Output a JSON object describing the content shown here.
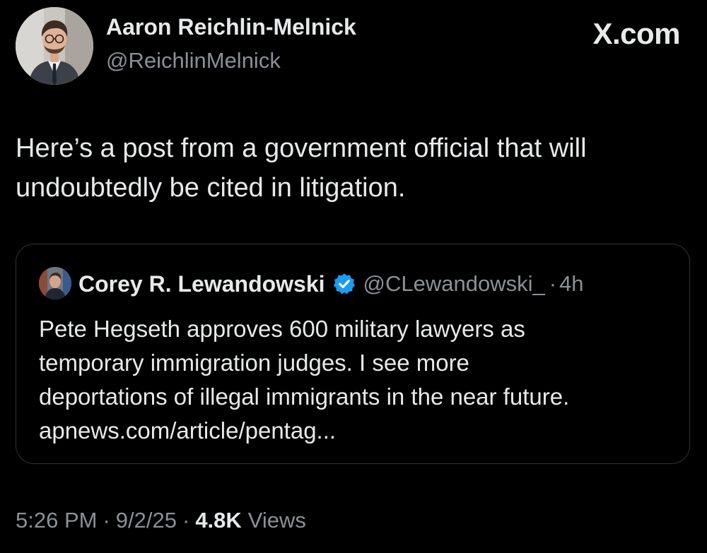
{
  "author": {
    "name": "Aaron Reichlin-Melnick",
    "handle": "@ReichlinMelnick"
  },
  "brand": "X.com",
  "post": {
    "text": "Here’s a post from a government official that will\nundoubtedly be cited in litigation."
  },
  "quoted": {
    "name": "Corey R. Lewandowski",
    "handle": "@CLewandowski_",
    "separator": "·",
    "time": "4h",
    "text": "Pete Hegseth approves 600 military lawyers as\ntemporary immigration judges.  I see more\ndeportations of illegal immigrants in the near future.\napnews.com/article/pentag..."
  },
  "footer": {
    "time": "5:26 PM",
    "date": "9/2/25",
    "separator": "·",
    "views_count": "4.8K",
    "views_label": "Views"
  },
  "icons": {
    "verified": "verified-badge-icon"
  },
  "colors": {
    "background": "#000000",
    "text_primary": "#e7e9ea",
    "text_secondary": "#8b9096",
    "border": "#2f3336",
    "verified_blue": "#1d9bf0"
  }
}
